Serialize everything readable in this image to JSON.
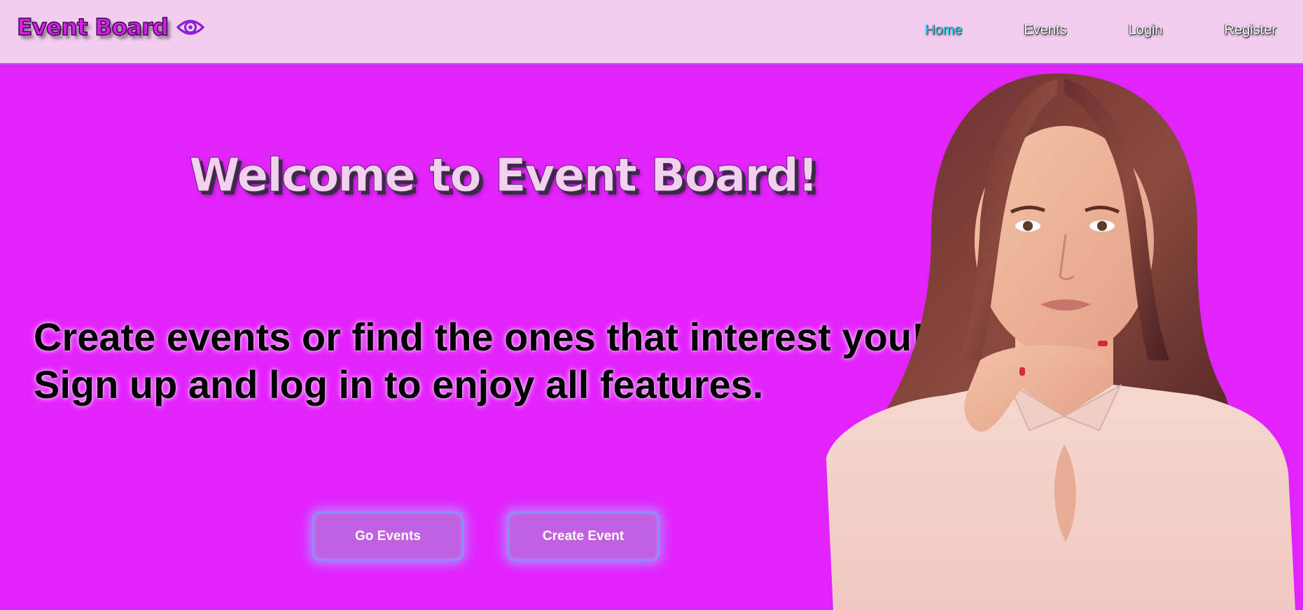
{
  "header": {
    "brand": {
      "name": "Event Board",
      "icon": "eye-icon"
    },
    "nav": [
      {
        "label": "Home",
        "active": true
      },
      {
        "label": "Events",
        "active": false
      },
      {
        "label": "Login",
        "active": false
      },
      {
        "label": "Register",
        "active": false
      }
    ]
  },
  "hero": {
    "title": "Welcome to Event Board!",
    "subtitle_line1": "Create events or find the ones that interest you!",
    "subtitle_line2": "Sign up and log in to enjoy all features.",
    "buttons": {
      "go_events": "Go Events",
      "create_event": "Create Event"
    },
    "image": "woman-portrait"
  },
  "colors": {
    "background": "#e323fd",
    "header_bg": "#f2cdef",
    "nav_active": "#20c8f0",
    "nav_text": "#ffffff",
    "brand": "#d61fe8",
    "button_bg": "#c260e2",
    "button_border": "#8e8cff",
    "title_fill": "#f1d1ee"
  }
}
